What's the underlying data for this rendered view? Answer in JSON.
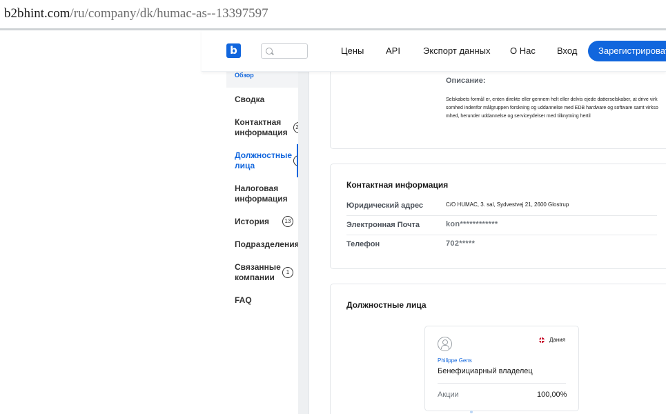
{
  "browser": {
    "url_host": "b2bhint.com",
    "url_path": "/ru/company/dk/humac-as--13397597"
  },
  "header": {
    "logo": "b",
    "nav": [
      "Цены",
      "API",
      "Экспорт данных",
      "О Нас",
      "Вход"
    ],
    "signup": "Зарегистрировать"
  },
  "sidebar": {
    "active_top": "Обзор",
    "items": [
      {
        "label": "Сводка",
        "badge": ""
      },
      {
        "label": "Контактная информация",
        "badge": "2"
      },
      {
        "label": "Должностные лица",
        "badge": ""
      },
      {
        "label": "Налоговая информация",
        "badge": ""
      },
      {
        "label": "История",
        "badge": "13"
      },
      {
        "label": "Подразделения",
        "badge": ""
      },
      {
        "label": "Связанные компании",
        "badge": "1"
      },
      {
        "label": "FAQ",
        "badge": ""
      }
    ]
  },
  "overview": {
    "description_label": "Описание:",
    "description_text": "Selskabets formål er, enten direkte eller gennem helt eller delvis ejede datterselskaber, at drive virksomhed indenfor målgruppen forskning og uddannelse med EDB hardware og software samt virksomhed, herunder uddannelse og serviceydelser med tilknytning hertil"
  },
  "contact": {
    "title": "Контактная информация",
    "rows": [
      {
        "label": "Юридический адрес",
        "value": "C/O HUMAC, 3. sal, Sydvestvej 21, 2600 Glostrup"
      },
      {
        "label": "Электронная Почта",
        "value": "kon************"
      },
      {
        "label": "Телефон",
        "value": "702*****"
      }
    ]
  },
  "officers": {
    "title": "Должностные лица",
    "person": {
      "country": "Дания",
      "name": "Philippe Gens",
      "role": "Бенефициарный владелец",
      "shares_label": "Акции",
      "shares_value": "100,00%"
    }
  },
  "colors": {
    "accent": "#1166dd",
    "flag_red": "#c8102e",
    "sidebar_gutter": "#eef0f2"
  }
}
